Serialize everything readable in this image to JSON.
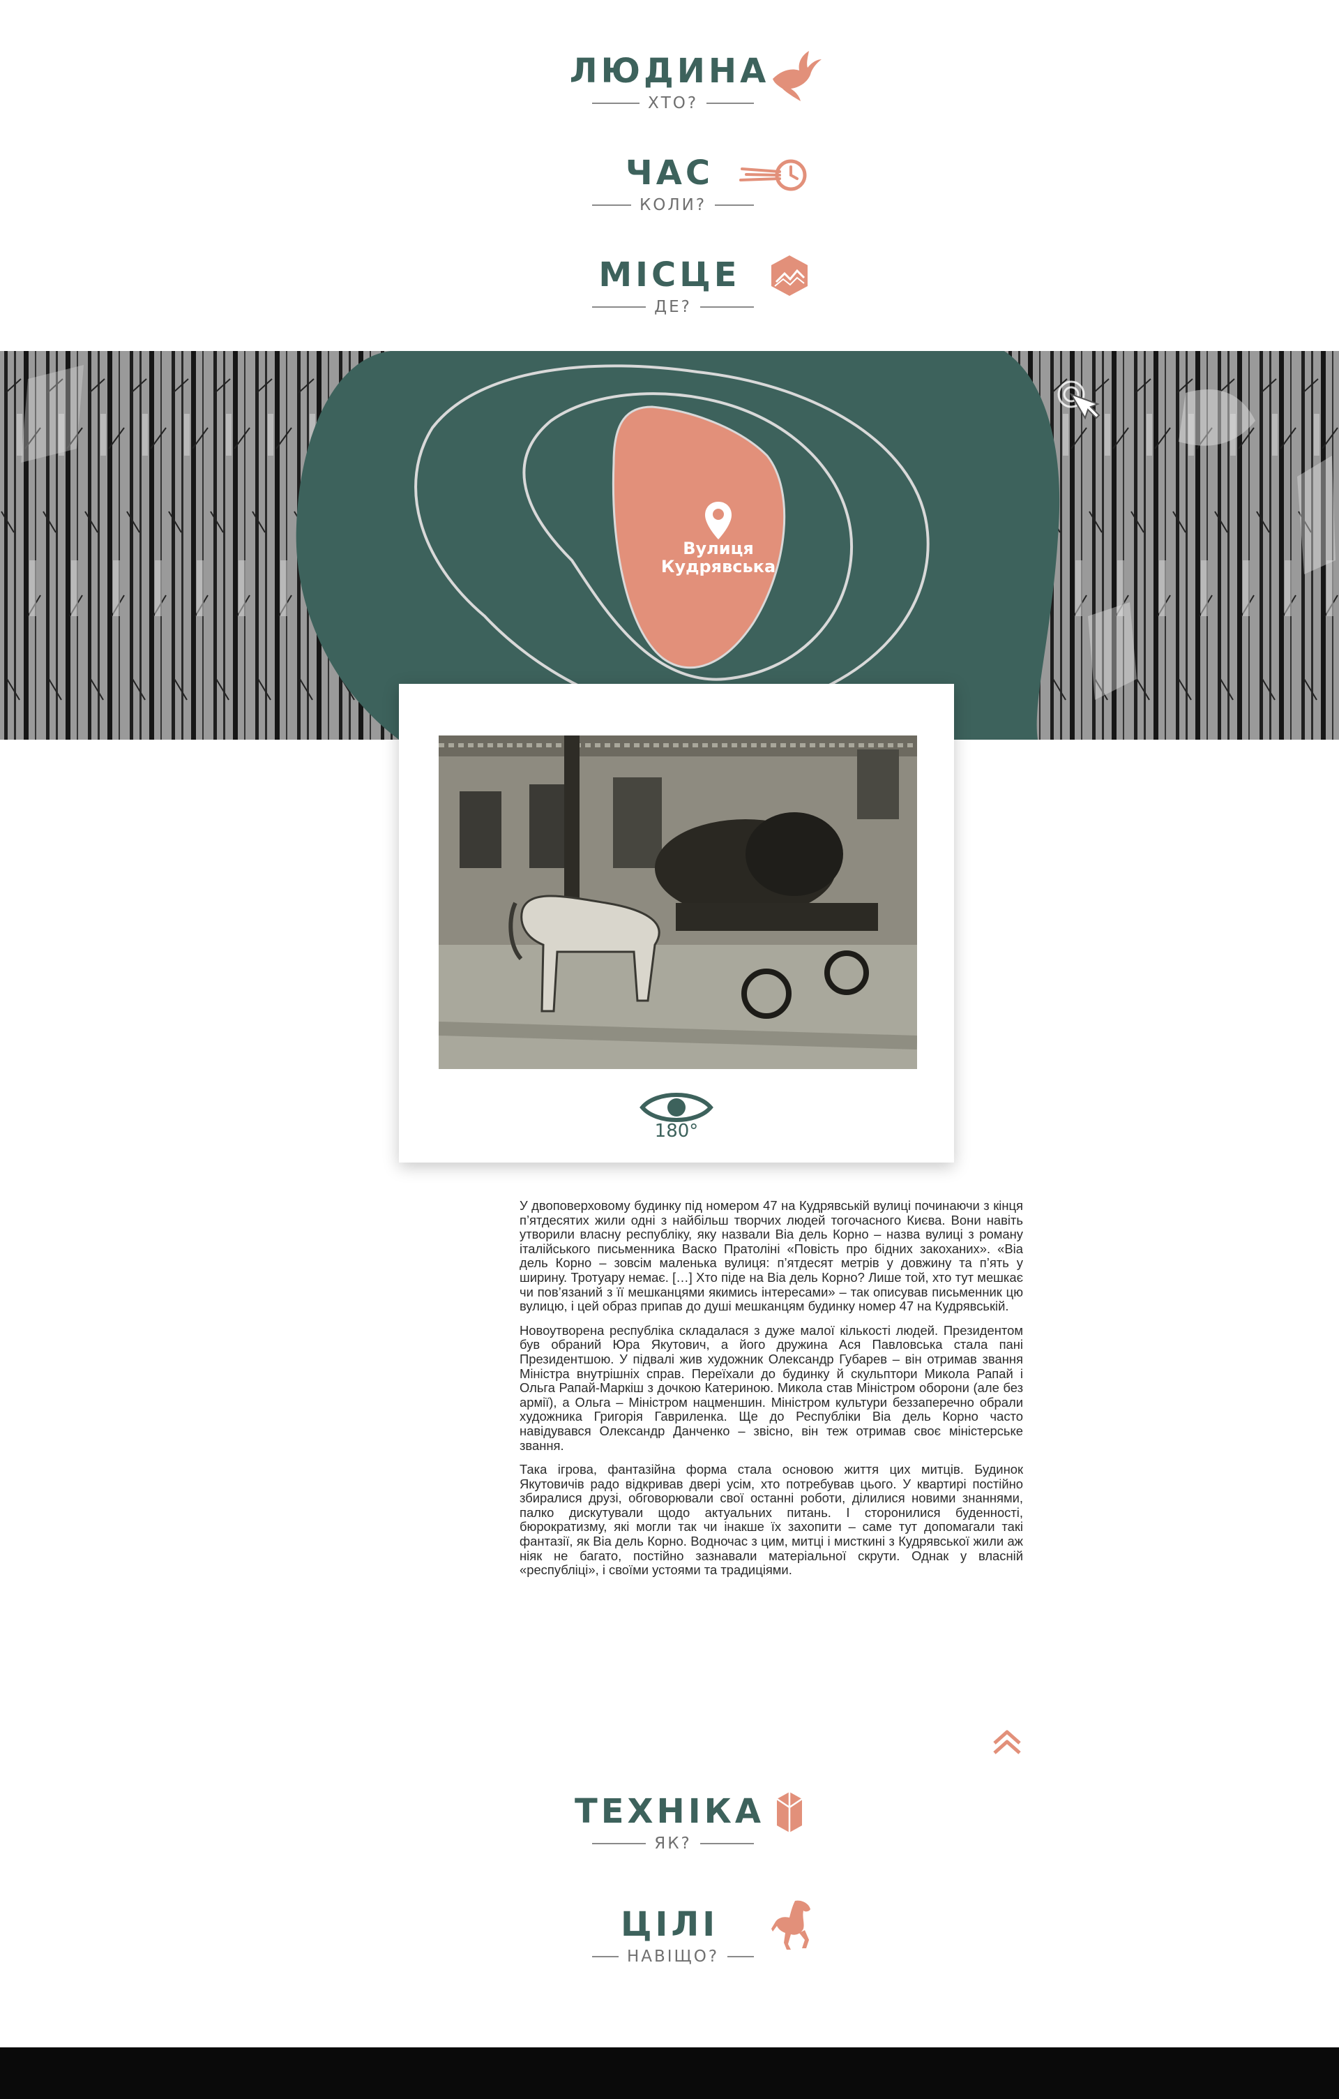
{
  "nav": [
    {
      "title": "ЛЮДИНА",
      "subtitle": "ХТО?",
      "icon": "swallow-icon"
    },
    {
      "title": "ЧАС",
      "subtitle": "КОЛИ?",
      "icon": "flying-clock-icon"
    },
    {
      "title": "МІСЦЕ",
      "subtitle": "ДЕ?",
      "icon": "hexagon-map-icon"
    }
  ],
  "map": {
    "location_label": "Вулиця Кудрявська",
    "location_icon": "map-pin-icon",
    "cursor_icon": "click-cursor-icon"
  },
  "card": {
    "photo": "horse-cart-photo",
    "view_icon": "eye-icon",
    "view_label": "180°"
  },
  "article": {
    "paragraphs": [
      "У двоповерховому будинку під номером 47 на Кудрявській вулиці починаючи з кінця п’ятдесятих жили одні з найбільш творчих людей тогочасного Києва. Вони навіть утворили власну республіку, яку назвали Віа дель Корно – назва вулиці з роману італійського письменника Васко Пратоліні «Повість про бідних закоханих». «Віа дель Корно – зовсім маленька вулиця: п’ятдесят метрів у довжину та п’ять у ширину. Тротуару немає. […] Хто піде на Віа дель Корно? Лише той, хто тут мешкає чи пов’язаний з її мешканцями якимись інтересами» – так описував письменник цю вулицю, і цей образ припав до душі мешканцям будинку номер 47 на Кудрявській.",
      "Новоутворена республіка складалася з дуже малої кількості людей. Президентом був обраний Юра Якутович, а його дружина Ася Павловська стала пані Президентшою. У підвалі жив художник Олександр Губарев – він отримав звання Міністра внутрішніх справ. Переїхали до будинку й скульптори Микола Рапай і Ольга Рапай-Маркіш з дочкою Катериною. Микола став Міністром оборони (але без армії), а Ольга – Міністром нацменшин. Міністром культури беззаперечно обрали художника Григорія Гавриленка. Ще до Республіки Віа дель Корно часто навідувався Олександр Данченко – звісно, він теж отримав своє міністерське звання.",
      "Така ігрова, фантазійна форма стала основою життя цих митців. Будинок Якутовичів радо відкривав двері усім, хто потребував цього. У квартирі постійно збиралися друзі, обговорювали свої останні роботи, ділилися новими знаннями, палко дискутували щодо актуальних питань. І сторонилися буденності, бюрократизму, які могли так чи інакше їх захопити – саме тут допомагали такі фантазії, як Віа дель Корно. Водночас з цим, митці і мисткині з Кудрявської жили аж ніяк не багато, постійно зазнавали матеріальної скрути. Однак у власній «республіці», і своїми устоями та традиціями."
    ]
  },
  "scroll_up_icon": "double-chevron-up-icon",
  "nav_bottom": [
    {
      "title": "ТЕХНІКА",
      "subtitle": "ЯК?",
      "icon": "crystal-icon"
    },
    {
      "title": "ЦІЛІ",
      "subtitle": "НАВІЩО?",
      "icon": "horse-icon"
    }
  ],
  "colors": {
    "teal": "#3d625c",
    "accent": "#e2907a",
    "footer": "#0a0a0a"
  }
}
